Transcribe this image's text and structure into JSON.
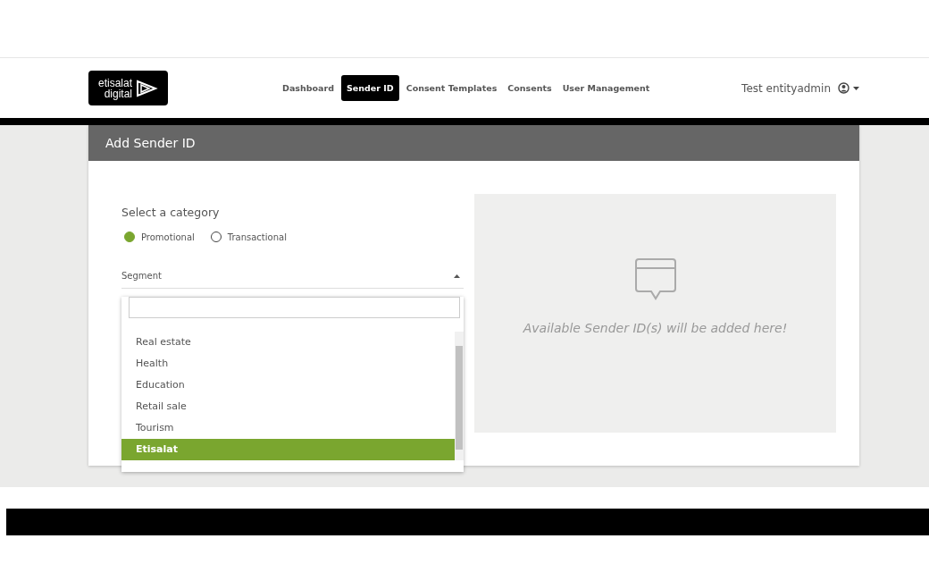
{
  "logo": {
    "line1": "etisalat",
    "line2": "digital"
  },
  "nav": [
    {
      "label": "Dashboard",
      "selected": false
    },
    {
      "label": "Sender ID",
      "selected": true
    },
    {
      "label": "Consent Templates",
      "selected": false
    },
    {
      "label": "Consents",
      "selected": false
    },
    {
      "label": "User Management",
      "selected": false
    }
  ],
  "user": {
    "name": "Test entityadmin"
  },
  "card": {
    "title": "Add Sender ID"
  },
  "category": {
    "label": "Select a category",
    "options": [
      {
        "label": "Promotional",
        "selected": true
      },
      {
        "label": "Transactional",
        "selected": false
      }
    ]
  },
  "segment": {
    "label": "Segment",
    "expanded": true,
    "items": [
      {
        "label": "Real estate",
        "selected": false
      },
      {
        "label": "Health",
        "selected": false
      },
      {
        "label": "Education",
        "selected": false
      },
      {
        "label": "Retail sale",
        "selected": false
      },
      {
        "label": "Tourism",
        "selected": false
      },
      {
        "label": "Etisalat",
        "selected": true
      }
    ]
  },
  "empty_state": {
    "message": "Available Sender ID(s) will be added here!"
  }
}
